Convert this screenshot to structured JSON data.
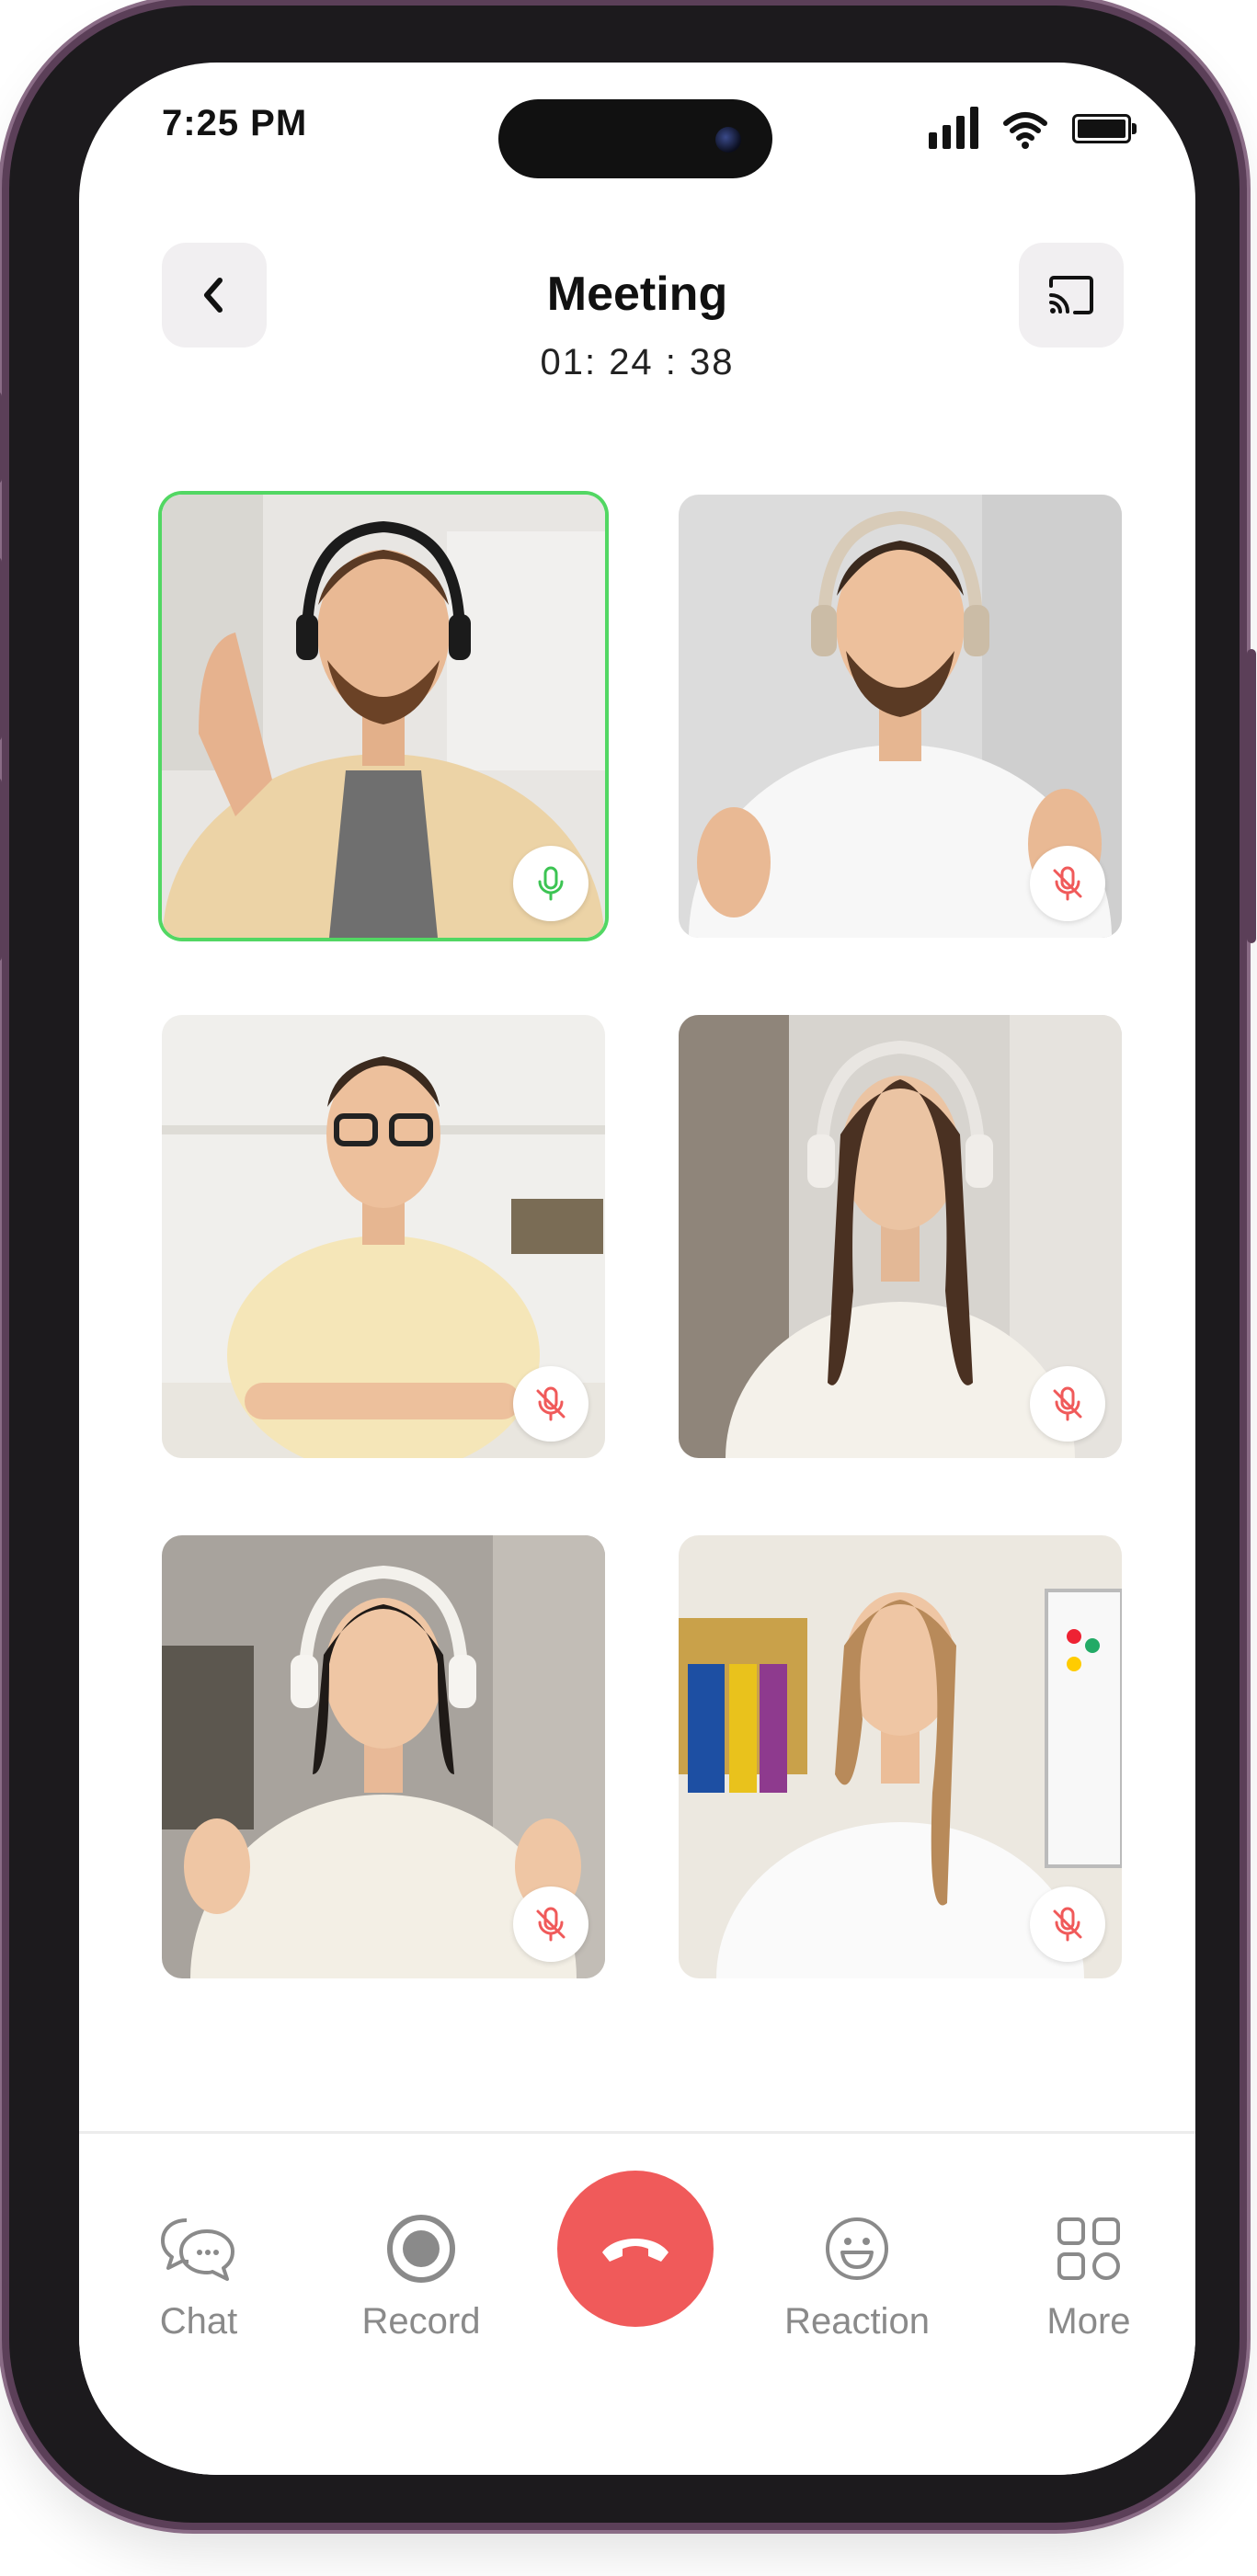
{
  "status_bar": {
    "time": "7:25 PM"
  },
  "header": {
    "title": "Meeting",
    "timer": "01: 24 : 38"
  },
  "participants": [
    {
      "id": "p1",
      "speaking": true,
      "muted": false
    },
    {
      "id": "p2",
      "speaking": false,
      "muted": true
    },
    {
      "id": "p3",
      "speaking": false,
      "muted": true
    },
    {
      "id": "p4",
      "speaking": false,
      "muted": true
    },
    {
      "id": "p5",
      "speaking": false,
      "muted": true
    },
    {
      "id": "p6",
      "speaking": false,
      "muted": true
    }
  ],
  "bottom_nav": {
    "chat": "Chat",
    "record": "Record",
    "reaction": "Reaction",
    "more": "More"
  },
  "colors": {
    "speaking_border": "#52d763",
    "mic_on": "#3cc453",
    "mic_off": "#f05a5a",
    "end_call": "#f05a5a",
    "frame": "#5b3f58"
  }
}
